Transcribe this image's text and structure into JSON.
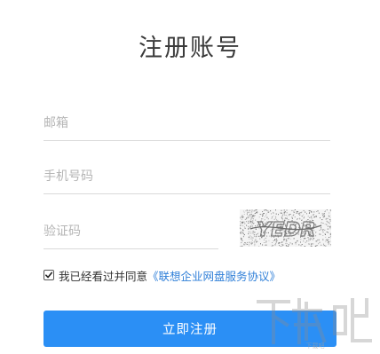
{
  "form": {
    "title": "注册账号",
    "email_placeholder": "邮箱",
    "phone_placeholder": "手机号码",
    "captcha_placeholder": "验证码",
    "captcha_text": "YEDR",
    "agree_checked": true,
    "agree_text": "我已经看过并同意",
    "agree_link": "《联想企业网盘服务协议》",
    "submit_label": "立即注册"
  },
  "watermark": {
    "logo_text": "下载吧"
  },
  "colors": {
    "accent": "#2b8ff5",
    "link": "#2f7fd8",
    "title": "#3a3a3a",
    "placeholder": "#b5b5b5",
    "divider": "#d9d9d9"
  }
}
